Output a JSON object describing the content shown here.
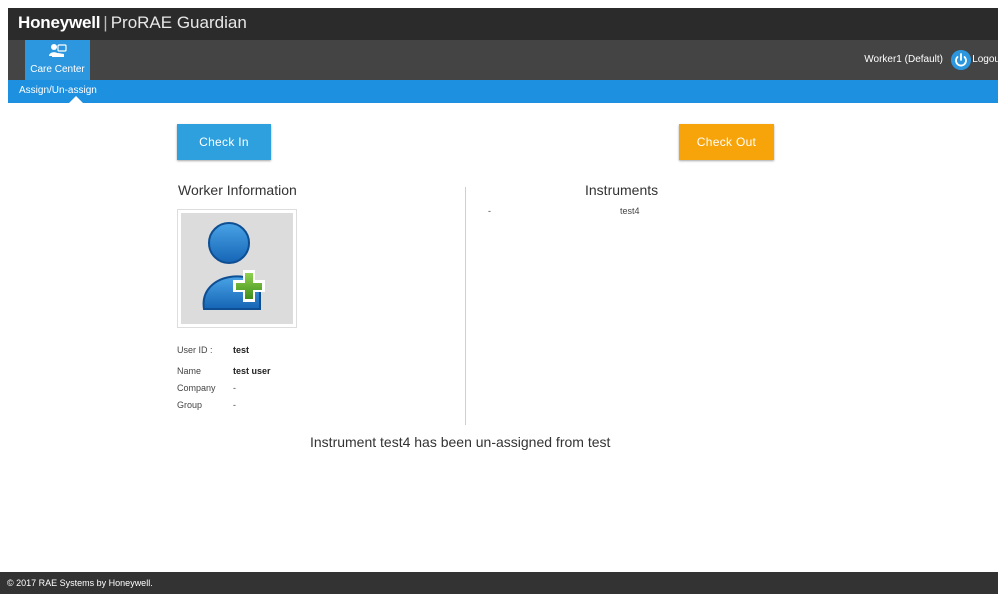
{
  "header": {
    "brand": "Honeywell",
    "separator": "|",
    "product": "ProRAE Guardian"
  },
  "nav": {
    "care_center_label": "Care Center",
    "care_center_icon": "care-center-icon",
    "user": "Worker1 (Default)",
    "logout_label": "Logou"
  },
  "subnav": {
    "active_tab": "Assign/Un-assign"
  },
  "actions": {
    "check_in": "Check In",
    "check_out": "Check Out"
  },
  "worker": {
    "heading": "Worker Information",
    "fields": [
      {
        "label": "User ID :",
        "value": "test"
      },
      {
        "label": "Name",
        "value": "test user"
      },
      {
        "label": "Company",
        "value": "-"
      },
      {
        "label": "Group",
        "value": "-"
      }
    ]
  },
  "instruments": {
    "heading": "Instruments",
    "rows": [
      {
        "dash": "-",
        "name": "test4"
      }
    ]
  },
  "message": "Instrument test4 has been un-assigned from test",
  "footer": "© 2017 RAE Systems by Honeywell.",
  "colors": {
    "topbar": "#2b2b2b",
    "navbar": "#444444",
    "accent_blue": "#2c97de",
    "subbar_blue": "#1e90e0",
    "check_in": "#2ea0de",
    "check_out": "#f7a30a",
    "footer": "#333333"
  }
}
